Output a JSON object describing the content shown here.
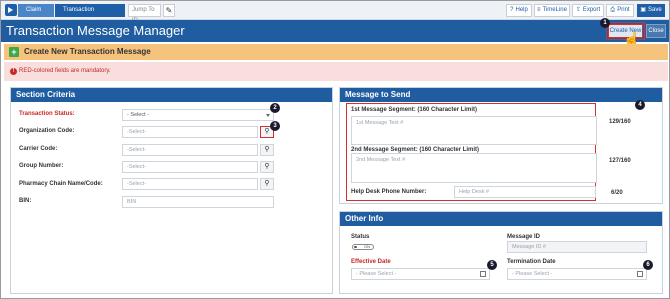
{
  "toolbar": {
    "breadcrumb": [
      "Claim",
      "Transaction Message Manager"
    ],
    "jump_placeholder": "Jump To ID",
    "buttons": [
      {
        "label": "Help",
        "icon": "help-icon",
        "glyph": "?"
      },
      {
        "label": "TimeLine",
        "icon": "timeline-icon",
        "glyph": "≡"
      },
      {
        "label": "Export",
        "icon": "export-icon",
        "glyph": "⇪"
      },
      {
        "label": "Print",
        "icon": "print-icon",
        "glyph": "⎙"
      },
      {
        "label": "Save",
        "icon": "save-icon",
        "glyph": "▣"
      }
    ]
  },
  "header": {
    "title": "Transaction Message Manager",
    "create_label": "Create New",
    "close_label": "Close"
  },
  "banner": {
    "title": "Create New Transaction Message",
    "mandatory_note": "RED-colored fields are mandatory."
  },
  "criteria": {
    "heading": "Section Criteria",
    "status_label": "Transaction Status:",
    "status_value": "- Select -",
    "org_label": "Organization Code:",
    "org_placeholder": "-Select-",
    "carrier_label": "Carrier Code:",
    "carrier_placeholder": "-Select-",
    "group_label": "Group Number:",
    "group_placeholder": "-Select-",
    "pharmacy_label": "Pharmacy Chain Name/Code:",
    "pharmacy_placeholder": "-Select-",
    "bin_label": "BIN:",
    "bin_placeholder": "BIN"
  },
  "message": {
    "heading": "Message to Send",
    "seg1_label": "1st Message Segment: (160 Character Limit)",
    "seg1_placeholder": "1st Message Text #",
    "seg1_count": "129/160",
    "seg2_label": "2nd Message Segment: (160 Character Limit)",
    "seg2_placeholder": "2nd Message Text #",
    "seg2_count": "127/160",
    "helpdesk_label": "Help Desk Phone Number:",
    "helpdesk_placeholder": "Help Desk #",
    "helpdesk_count": "6/20"
  },
  "other": {
    "heading": "Other Info",
    "status_label": "Status",
    "status_toggle": "ON",
    "message_id_label": "Message ID",
    "message_id_placeholder": "Message ID #",
    "effective_label": "Effective Date",
    "effective_placeholder": "- Please Select -",
    "termination_label": "Termination Date",
    "termination_placeholder": "- Please Select -"
  },
  "badges": [
    "1",
    "2",
    "3",
    "4",
    "5",
    "6"
  ],
  "colors": {
    "primary": "#1f5da0",
    "banner": "#f6c37c",
    "alert_bg": "#f9dede",
    "required": "#c62828",
    "highlight": "#d32f2f"
  }
}
